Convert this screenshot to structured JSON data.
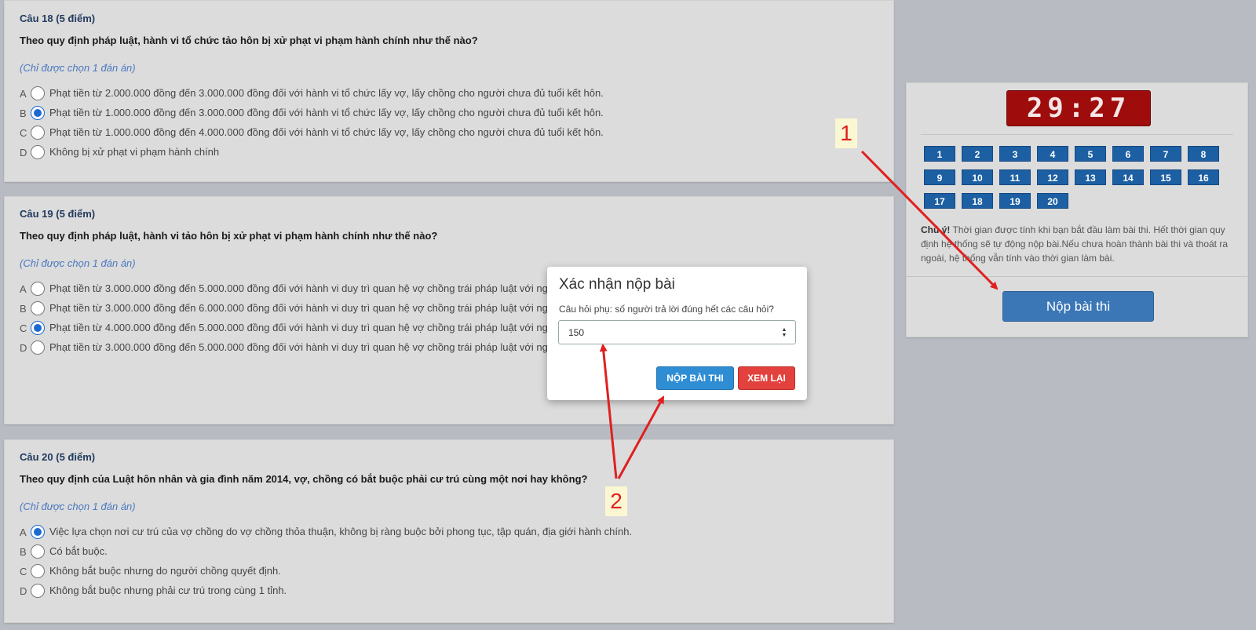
{
  "questions": [
    {
      "header": "Câu 18 (5 điểm)",
      "text": "Theo quy định pháp luật, hành vi tổ chức tảo hôn bị xử phạt vi phạm hành chính như thế nào?",
      "note": "(Chỉ được chọn 1 đán án)",
      "options": [
        {
          "letter": "A",
          "text": "Phạt tiền từ 2.000.000 đồng đến 3.000.000 đồng đối với hành vi tổ chức lấy vợ, lấy chồng cho người chưa đủ tuổi kết hôn.",
          "selected": false
        },
        {
          "letter": "B",
          "text": "Phạt tiền từ 1.000.000 đồng đến 3.000.000 đồng đối với hành vi tổ chức lấy vợ, lấy chồng cho người chưa đủ tuổi kết hôn.",
          "selected": true
        },
        {
          "letter": "C",
          "text": "Phạt tiền từ 1.000.000 đồng đến 4.000.000 đồng đối với hành vi tổ chức lấy vợ, lấy chồng cho người chưa đủ tuổi kết hôn.",
          "selected": false
        },
        {
          "letter": "D",
          "text": "Không bị xử phạt vi phạm hành chính",
          "selected": false
        }
      ]
    },
    {
      "header": "Câu 19 (5 điểm)",
      "text": "Theo quy định pháp luật, hành vi tảo hôn bị xử phạt vi phạm hành chính như thế nào?",
      "note": "(Chỉ được chọn 1 đán án)",
      "options": [
        {
          "letter": "A",
          "text": "Phạt tiền từ 3.000.000 đồng đến 5.000.000 đồng đối với hành vi duy trì quan hệ vợ chồng trái pháp luật với ng",
          "selected": false
        },
        {
          "letter": "B",
          "text": "Phạt tiền từ 3.000.000 đồng đến 6.000.000 đồng đối với hành vi duy trì quan hệ vợ chồng trái pháp luật với ng                                                                                                  đã có hiệu lực pháp luật của Toà án.",
          "selected": false
        },
        {
          "letter": "C",
          "text": "Phạt tiền từ 4.000.000 đồng đến 5.000.000 đồng đối với hành vi duy trì quan hệ vợ chồng trái pháp luật với ng                                                                                                  đã có hiệu lực pháp luật của Toà án.",
          "selected": true
        },
        {
          "letter": "D",
          "text": "Phạt tiền từ 3.000.000 đồng đến 5.000.000 đồng đối với hành vi duy trì quan hệ vợ chồng trái pháp luật với ng                                                                                                  đã có hiệu lực pháp luật của Toà án.",
          "selected": false
        }
      ]
    },
    {
      "header": "Câu 20 (5 điểm)",
      "text": "Theo quy định của Luật hôn nhân và gia đình năm 2014, vợ, chồng có bắt buộc phải cư trú cùng một nơi hay không?",
      "note": "(Chỉ được chọn 1 đán án)",
      "options": [
        {
          "letter": "A",
          "text": "Việc lựa chọn nơi cư trú của vợ chồng do vợ chồng thỏa thuận, không bị ràng buộc bởi phong tục, tập quán, địa giới hành chính.",
          "selected": true
        },
        {
          "letter": "B",
          "text": "Có bắt buộc.",
          "selected": false
        },
        {
          "letter": "C",
          "text": "Không bắt buộc nhưng do người chồng quyết định.",
          "selected": false
        },
        {
          "letter": "D",
          "text": "Không bắt buộc nhưng phải cư trú trong cùng 1 tỉnh.",
          "selected": false
        }
      ]
    }
  ],
  "panel": {
    "timer": "29:27",
    "question_numbers": [
      "1",
      "2",
      "3",
      "4",
      "5",
      "6",
      "7",
      "8",
      "9",
      "10",
      "11",
      "12",
      "13",
      "14",
      "15",
      "16",
      "17",
      "18",
      "19",
      "20"
    ],
    "notice_bold": "Chú ý!",
    "notice_text": " Thời gian được tính khi bạn bắt đầu làm bài thi. Hết thời gian quy định hệ thống sẽ tự động nộp bài.Nếu chưa hoàn thành bài thi và thoát ra ngoài, hệ thống vẫn tính vào thời gian làm bài.",
    "submit_label": "Nộp bài thi"
  },
  "modal": {
    "title": "Xác nhận nộp bài",
    "label": "Câu hỏi phụ: số người trả lời đúng hết các câu hỏi?",
    "input_value": "150",
    "submit_label": "NỘP BÀI THI",
    "review_label": "XEM LẠI"
  },
  "annotations": {
    "label_1": "1",
    "label_2": "2"
  },
  "colors": {
    "timer_bg": "#9e0c0c",
    "question_button": "#1d5fa3",
    "submit_button": "#3b77b6",
    "modal_submit": "#2f8dd4",
    "modal_review": "#e2413d",
    "annotation": "#e02020"
  },
  "icons": {
    "spinner": "number-spinner-icon",
    "radio": "radio-button"
  }
}
